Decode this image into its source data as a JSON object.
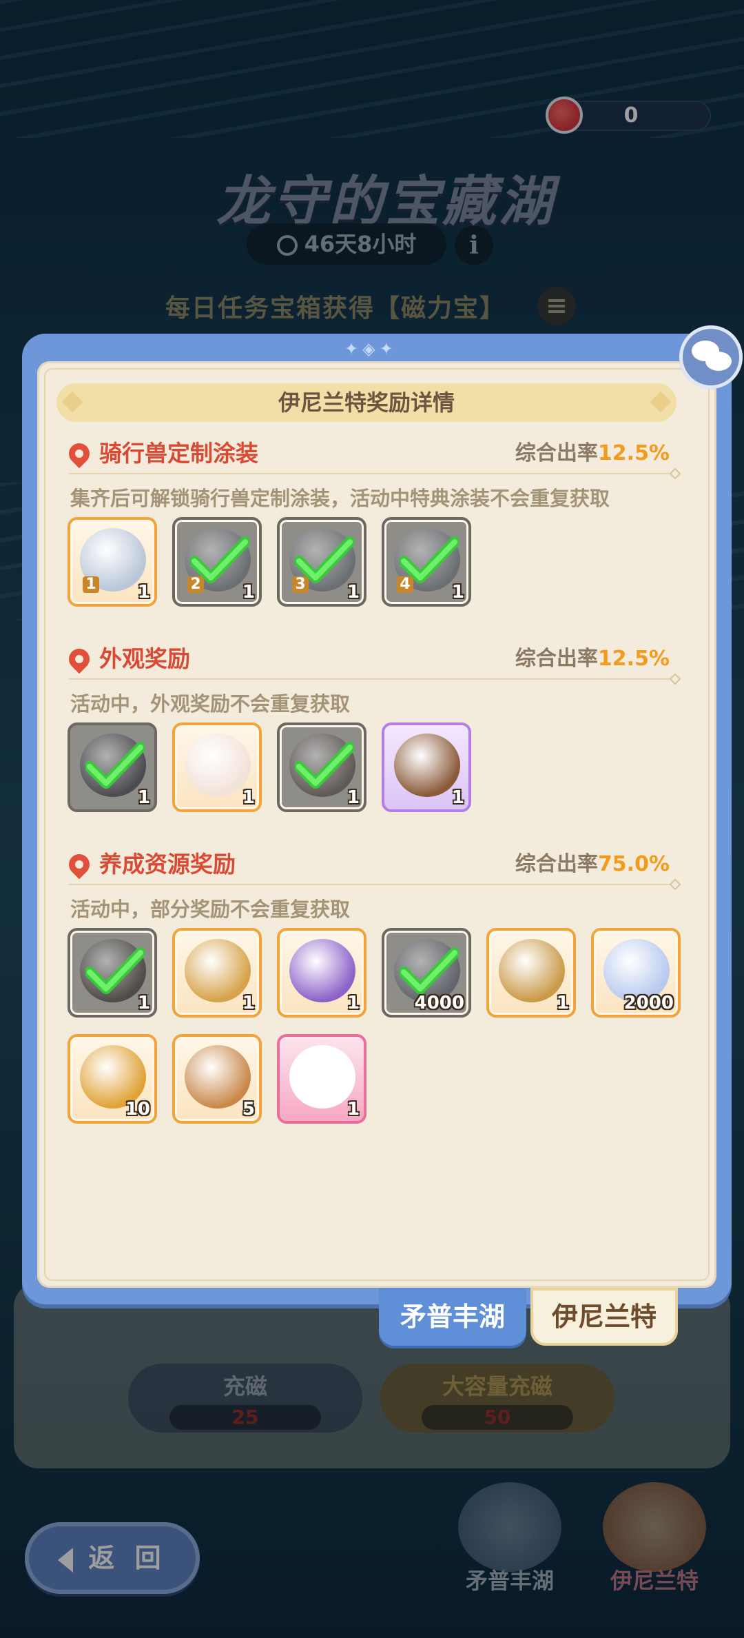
{
  "currency": {
    "icon": "magnet-icon",
    "value": "0"
  },
  "event_title": "龙守的宝藏湖",
  "timer": {
    "icon": "clock-icon",
    "text": "46天8小时"
  },
  "info_label": "i",
  "daily_task_text": "每日任务宝箱获得【磁力宝】",
  "charge": {
    "normal": {
      "label": "充磁",
      "cost": "25"
    },
    "large": {
      "label": "大容量充磁",
      "cost": "50"
    }
  },
  "back_label": "返 回",
  "bottom_nav": [
    "矛普丰湖",
    "伊尼兰特"
  ],
  "modal": {
    "header": "伊尼兰特奖励详情",
    "sections": [
      {
        "title": "骑行兽定制涂装",
        "rate_label": "综合出率",
        "rate_value": "12.5%",
        "desc": "集齐后可解锁骑行兽定制涂装，活动中特典涂装不会重复获取",
        "items": [
          {
            "name": "mount-skin-1",
            "count": "1",
            "level": "1",
            "owned": false,
            "frame": "orange",
            "color": "#b9c6d8"
          },
          {
            "name": "mount-skin-2",
            "count": "1",
            "level": "2",
            "owned": true,
            "frame": "orange",
            "color": "#8fa0b5"
          },
          {
            "name": "mount-skin-3",
            "count": "1",
            "level": "3",
            "owned": true,
            "frame": "orange",
            "color": "#8fa0b5"
          },
          {
            "name": "mount-skin-4",
            "count": "1",
            "level": "4",
            "owned": true,
            "frame": "orange",
            "color": "#8fa0b5"
          }
        ]
      },
      {
        "title": "外观奖励",
        "rate_label": "综合出率",
        "rate_value": "12.5%",
        "desc": "活动中，外观奖励不会重复获取",
        "items": [
          {
            "name": "glasses-accessory",
            "count": "1",
            "owned": true,
            "frame": "purple",
            "color": "#6d6a85"
          },
          {
            "name": "feather-fan",
            "count": "1",
            "owned": false,
            "frame": "orange",
            "color": "#f2e2d8"
          },
          {
            "name": "arch-decoration",
            "count": "1",
            "owned": true,
            "frame": "orange",
            "color": "#9c7c6a"
          },
          {
            "name": "photo-frame",
            "count": "1",
            "owned": false,
            "frame": "purple",
            "color": "#8a5a3a"
          }
        ]
      },
      {
        "title": "养成资源奖励",
        "rate_label": "综合出率",
        "rate_value": "75.0%",
        "desc": "活动中，部分奖励不会重复获取",
        "items": [
          {
            "name": "treasure-map",
            "count": "1",
            "owned": true,
            "frame": "orange",
            "color": "#7d6a55"
          },
          {
            "name": "bell-chest",
            "count": "1",
            "owned": false,
            "frame": "orange",
            "color": "#d6a24a"
          },
          {
            "name": "purple-chest",
            "count": "1",
            "owned": false,
            "frame": "orange",
            "color": "#8c62c8"
          },
          {
            "name": "star-crystal",
            "count": "4000",
            "owned": true,
            "frame": "orange",
            "color": "#7f93b0"
          },
          {
            "name": "gold-chest",
            "count": "1",
            "owned": false,
            "frame": "orange",
            "color": "#c99a48"
          },
          {
            "name": "star-crystal-2",
            "count": "2000",
            "owned": false,
            "frame": "orange",
            "color": "#b7c9ef"
          },
          {
            "name": "golden-bell",
            "count": "10",
            "owned": false,
            "frame": "orange",
            "color": "#e0a236"
          },
          {
            "name": "wheat-bag",
            "count": "5",
            "owned": false,
            "frame": "orange",
            "color": "#c9884a"
          },
          {
            "name": "white-cat",
            "count": "1",
            "owned": false,
            "frame": "pink",
            "color": "#ffffff"
          }
        ]
      }
    ]
  },
  "tabs": [
    "矛普丰湖",
    "伊尼兰特"
  ],
  "colors": {
    "accent_red": "#d94a35",
    "rate_orange": "#f29b1c",
    "frame_blue": "#6e97da"
  }
}
